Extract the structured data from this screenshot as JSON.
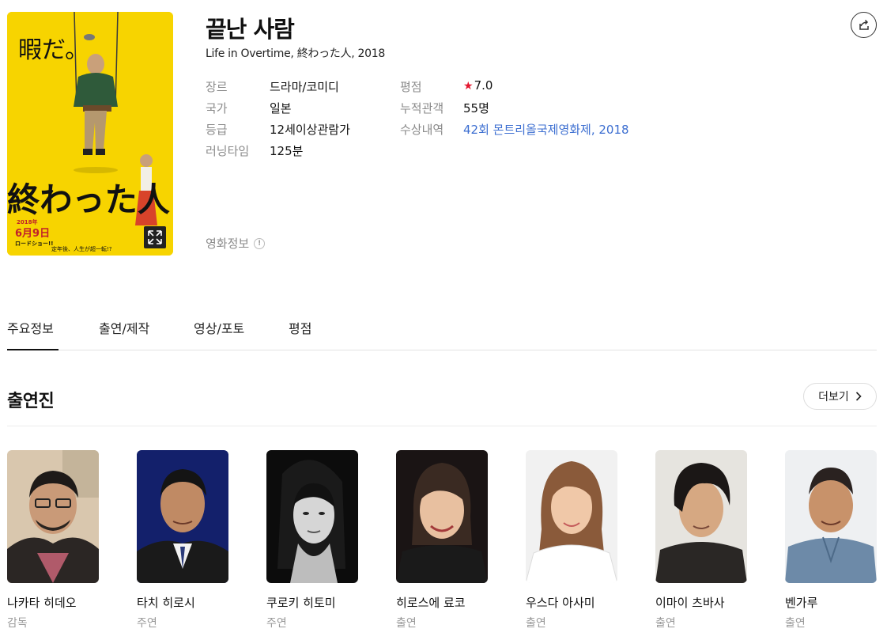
{
  "movie": {
    "title": "끝난 사람",
    "subtitle": "Life in Overtime, 終わった人, 2018",
    "poster": {
      "text_top": "暇だ。",
      "text_main": "終わった人",
      "text_date": "6月9日",
      "text_year": "2018年",
      "text_bottom_left": "ロードショー!!",
      "text_tagline": "定年後、人生が超一転!?"
    }
  },
  "info": {
    "genre_label": "장르",
    "genre_value": "드라마/코미디",
    "country_label": "국가",
    "country_value": "일본",
    "rating_label": "등급",
    "rating_value": "12세이상관람가",
    "runtime_label": "러닝타임",
    "runtime_value": "125분",
    "score_label": "평점",
    "score_value": "7.0",
    "audience_label": "누적관객",
    "audience_value": "55명",
    "awards_label": "수상내역",
    "awards_value": "42회 몬트리올국제영화제, 2018"
  },
  "movie_info_link": "영화정보",
  "tabs": [
    {
      "label": "주요정보",
      "active": true
    },
    {
      "label": "출연/제작",
      "active": false
    },
    {
      "label": "영상/포토",
      "active": false
    },
    {
      "label": "평점",
      "active": false
    }
  ],
  "cast_section": {
    "title": "출연진",
    "more_label": "더보기",
    "members": [
      {
        "name": "나카타 히데오",
        "role": "감독"
      },
      {
        "name": "타치 히로시",
        "role": "주연"
      },
      {
        "name": "쿠로키 히토미",
        "role": "주연"
      },
      {
        "name": "히로스에 료코",
        "role": "출연"
      },
      {
        "name": "우스다 아사미",
        "role": "출연"
      },
      {
        "name": "이마이 츠바사",
        "role": "출연"
      },
      {
        "name": "벤가루",
        "role": "출연"
      }
    ]
  },
  "colors": {
    "accent_link": "#3d6fd1",
    "star": "#e4172f",
    "poster_bg": "#f7d400"
  },
  "icons": {
    "share": "share-icon",
    "expand": "expand-icon",
    "star": "star-icon",
    "info": "info-icon",
    "chevron": "chevron-right-icon"
  }
}
